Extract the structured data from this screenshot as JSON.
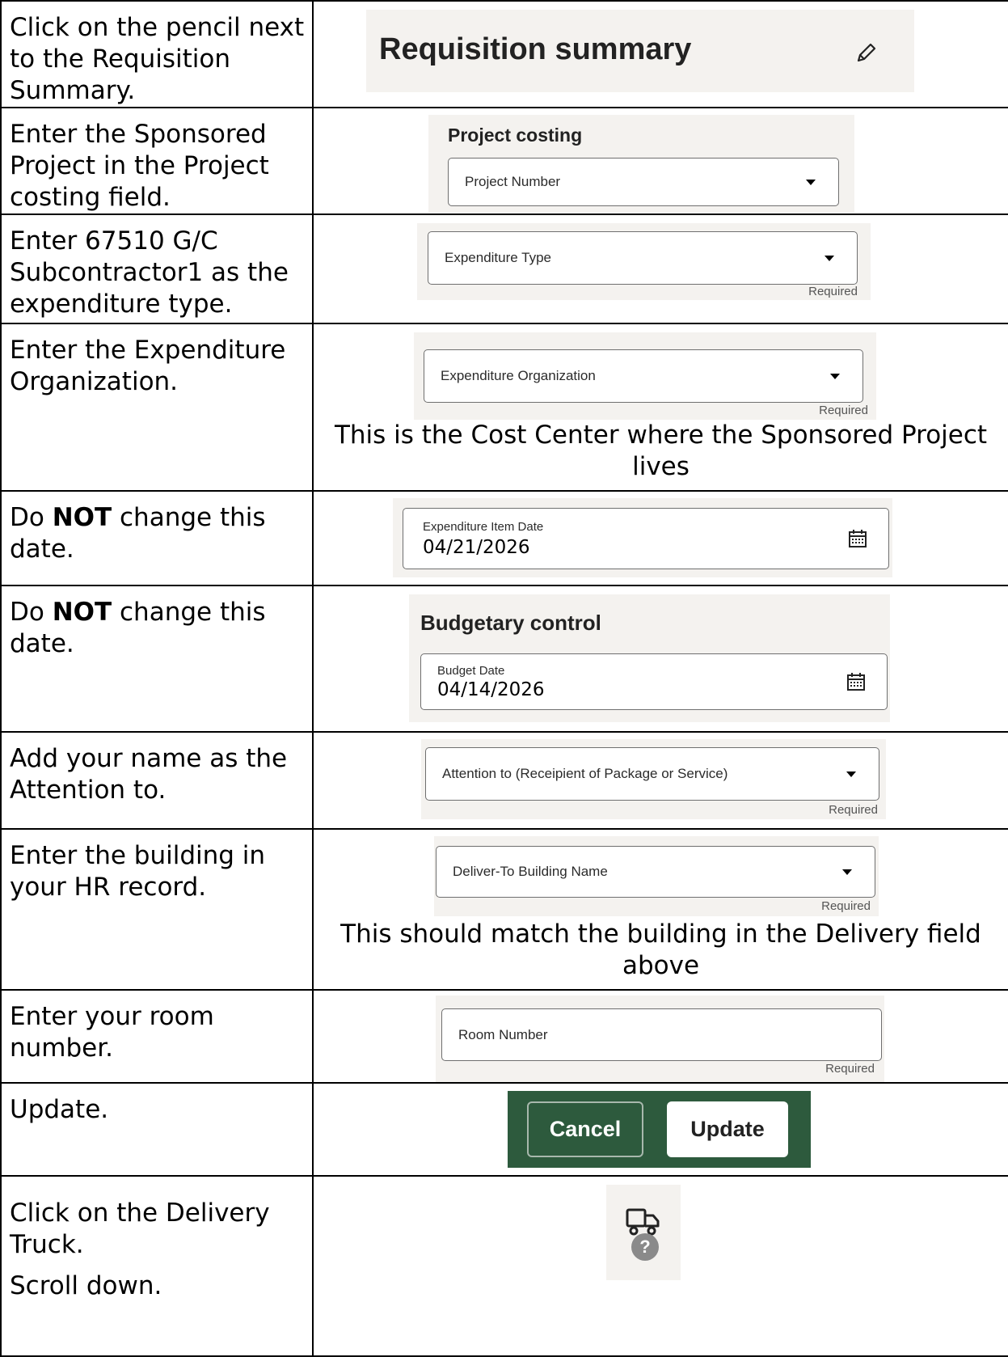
{
  "rows": [
    {
      "instruction": "Click on the pencil next to the Requisition Summary.",
      "shot": {
        "title": "Requisition summary",
        "icon": "pencil-icon"
      }
    },
    {
      "instruction": "Enter the Sponsored Project in the Project costing field.",
      "shot": {
        "heading": "Project costing",
        "field": "Project Number"
      }
    },
    {
      "instruction": "Enter 67510 G/C Subcontractor1 as the expenditure type.",
      "shot": {
        "field": "Expenditure Type",
        "required": "Required"
      }
    },
    {
      "instruction": "Enter the Expenditure Organization.",
      "shot": {
        "field": "Expenditure Organization",
        "required": "Required",
        "note": "This is the Cost Center where the Sponsored Project lives"
      }
    },
    {
      "instruction_pre": "Do ",
      "instruction_bold": "NOT",
      "instruction_post": " change this date.",
      "shot": {
        "label": "Expenditure Item Date",
        "value": "04/21/2026",
        "icon": "calendar-icon"
      }
    },
    {
      "instruction_pre": "Do ",
      "instruction_bold": "NOT",
      "instruction_post": " change this date.",
      "shot": {
        "heading": "Budgetary control",
        "label": "Budget Date",
        "value": "04/14/2026",
        "icon": "calendar-icon"
      }
    },
    {
      "instruction": "Add your name as the Attention to.",
      "shot": {
        "field": "Attention to (Receipient of Package or Service)",
        "required": "Required"
      }
    },
    {
      "instruction": "Enter the building in your HR record.",
      "shot": {
        "field": "Deliver-To Building Name",
        "required": "Required",
        "note": "This should match the building in the Delivery field above"
      }
    },
    {
      "instruction": "Enter your room number.",
      "shot": {
        "field": "Room Number",
        "required": "Required"
      }
    },
    {
      "instruction": "Update.",
      "shot": {
        "cancel": "Cancel",
        "update": "Update"
      }
    },
    {
      "instruction": "Click on the Delivery Truck.",
      "instruction2": "Scroll down.",
      "shot": {
        "icon": "delivery-truck-icon",
        "badge": "?"
      }
    }
  ],
  "colors": {
    "panel": "#f4f2ef",
    "buttonbar": "#2d5a3d"
  }
}
